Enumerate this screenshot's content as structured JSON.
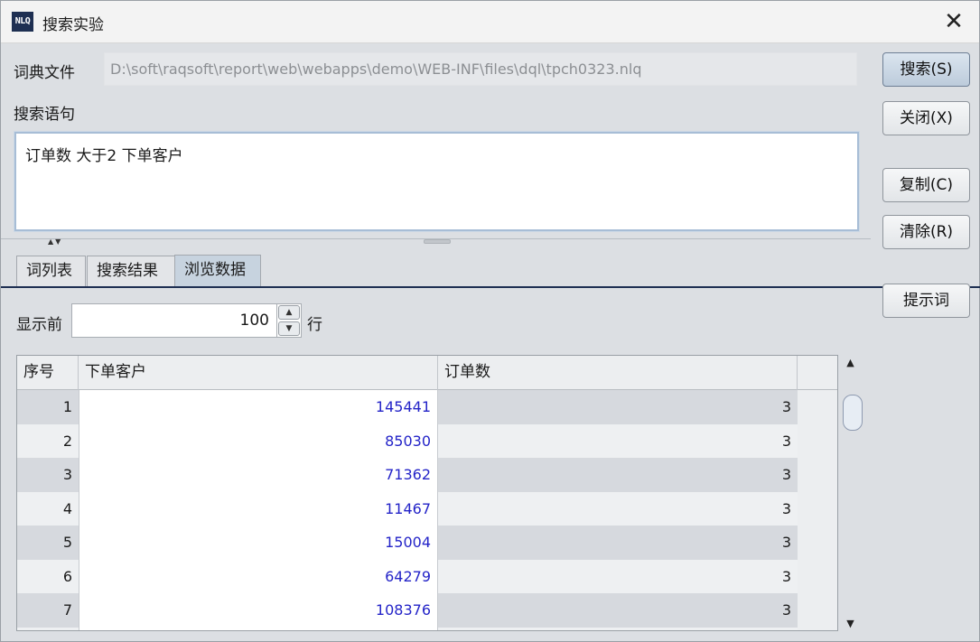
{
  "window": {
    "app_icon_text": "NLQ",
    "title": "搜索实验",
    "close_glyph": "✕"
  },
  "form": {
    "dict_label": "词典文件",
    "dict_path": "D:\\soft\\raqsoft\\report\\web\\webapps\\demo\\WEB-INF\\files\\dql\\tpch0323.nlq",
    "query_label": "搜索语句",
    "query_text": "订单数 大于2 下单客户"
  },
  "buttons": {
    "search": "搜索(S)",
    "close": "关闭(X)",
    "copy": "复制(C)",
    "clear": "清除(R)",
    "hint": "提示词"
  },
  "tabs": [
    {
      "label": "词列表",
      "active": false
    },
    {
      "label": "搜索结果",
      "active": false
    },
    {
      "label": "浏览数据",
      "active": true
    }
  ],
  "browse": {
    "show_prefix": "显示前",
    "show_count": "100",
    "show_suffix": "行"
  },
  "table": {
    "columns": [
      "序号",
      "下单客户",
      "订单数"
    ],
    "rows": [
      [
        "1",
        "145441",
        "3"
      ],
      [
        "2",
        "85030",
        "3"
      ],
      [
        "3",
        "71362",
        "3"
      ],
      [
        "4",
        "11467",
        "3"
      ],
      [
        "5",
        "15004",
        "3"
      ],
      [
        "6",
        "64279",
        "3"
      ],
      [
        "7",
        "108376",
        "3"
      ]
    ]
  },
  "icons": {
    "spin_up": "▲",
    "spin_down": "▼",
    "scroll_up": "▲",
    "scroll_down": "▼",
    "splitter_arrows": "▲▼"
  },
  "colors": {
    "accent": "#1e2f52",
    "link_text": "#2424c8"
  }
}
